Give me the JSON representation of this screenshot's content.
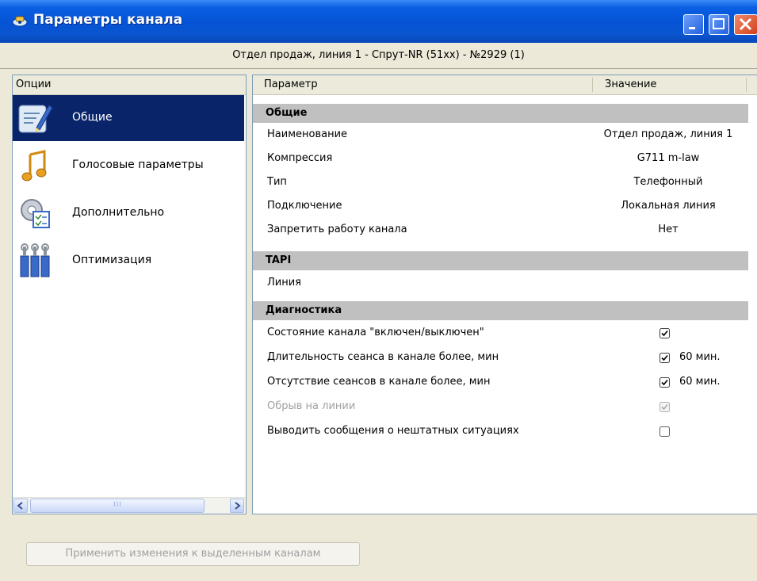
{
  "window": {
    "title": "Параметры канала"
  },
  "info": {
    "channel": "Отдел продаж, линия 1 - Спрут-NR (51xx) - №2929 (1)"
  },
  "options": {
    "header": "Опции",
    "items": [
      {
        "label": "Общие",
        "icon": "edit-icon",
        "selected": true
      },
      {
        "label": "Голосовые параметры",
        "icon": "music-note-icon",
        "selected": false
      },
      {
        "label": "Дополнительно",
        "icon": "gear-checklist-icon",
        "selected": false
      },
      {
        "label": "Оптимизация",
        "icon": "tools-icon",
        "selected": false
      }
    ],
    "scroll_grip": "III"
  },
  "table": {
    "col_param": "Параметр",
    "col_value": "Значение",
    "sections": [
      {
        "title": "Общие",
        "rows": [
          {
            "name": "Наименование",
            "value": "Отдел продаж, линия 1"
          },
          {
            "name": "Компрессия",
            "value": "G711 m-law"
          },
          {
            "name": "Тип",
            "value": "Телефонный"
          },
          {
            "name": "Подключение",
            "value": "Локальная линия"
          },
          {
            "name": "Запретить работу канала",
            "value": "Нет"
          }
        ]
      },
      {
        "title": "TAPI",
        "rows": [
          {
            "name": "Линия",
            "value": ""
          }
        ]
      },
      {
        "title": "Диагностика",
        "rows": [
          {
            "name": "Состояние канала \"включен/выключен\"",
            "checked": true,
            "extra": ""
          },
          {
            "name": "Длительность сеанса в канале более, мин",
            "checked": true,
            "extra": "60 мин."
          },
          {
            "name": "Отсутствие сеансов в канале более, мин",
            "checked": true,
            "extra": "60 мин."
          },
          {
            "name": "Обрыв на линии",
            "checked": true,
            "extra": "",
            "disabled": true
          },
          {
            "name": "Выводить сообщения о нештатных ситуациях",
            "checked": false,
            "extra": ""
          }
        ]
      }
    ]
  },
  "footer": {
    "apply_label": "Применить изменения к выделенным каналам"
  }
}
